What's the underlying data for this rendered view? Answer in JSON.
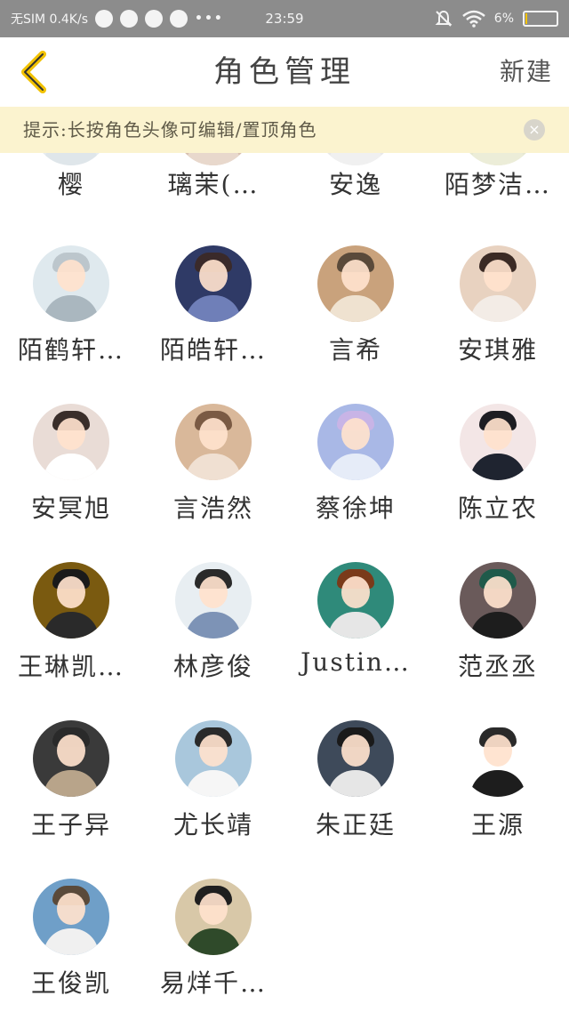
{
  "status_bar": {
    "carrier": "无SIM 0.4K/s",
    "time": "23:59",
    "battery": "6%",
    "battery_level": 0.06,
    "dots": "•••"
  },
  "header": {
    "back_icon": "chevron-left-icon",
    "title": "角色管理",
    "new_label": "新建"
  },
  "tip": {
    "text": "提示:长按角色头像可编辑/置顶角色",
    "close_icon": "×"
  },
  "partial_row": [
    {
      "name": "樱"
    },
    {
      "name": "璃茉(…"
    },
    {
      "name": "安逸"
    },
    {
      "name": "陌梦洁…"
    }
  ],
  "roles": [
    {
      "name": "陌鹤轩…"
    },
    {
      "name": "陌皓轩…"
    },
    {
      "name": "言希"
    },
    {
      "name": "安琪雅"
    },
    {
      "name": "安冥旭"
    },
    {
      "name": "言浩然"
    },
    {
      "name": "蔡徐坤"
    },
    {
      "name": "陈立农"
    },
    {
      "name": "王琳凯…"
    },
    {
      "name": "林彦俊"
    },
    {
      "name": "Justin…"
    },
    {
      "name": "范丞丞"
    },
    {
      "name": "王子异"
    },
    {
      "name": "尤长靖"
    },
    {
      "name": "朱正廷"
    },
    {
      "name": "王源"
    },
    {
      "name": "王俊凯"
    },
    {
      "name": "易烊千…"
    }
  ],
  "colors": {
    "accent": "#f2c200",
    "tip_bg": "#fbf3cf",
    "status_bg": "#8c8c8c"
  }
}
